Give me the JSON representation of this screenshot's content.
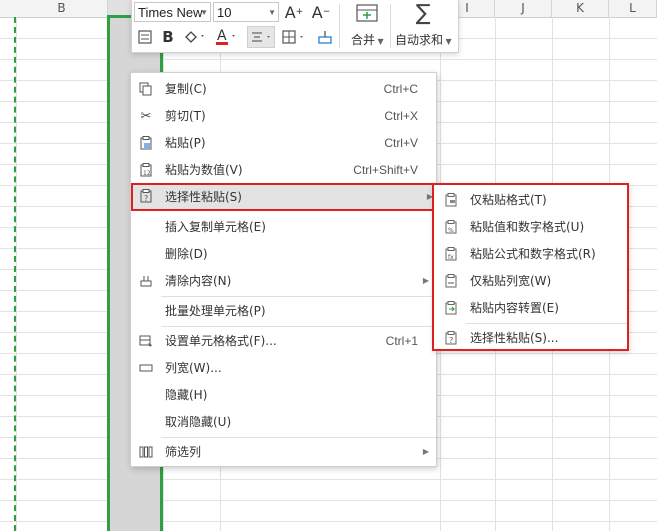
{
  "columns": [
    {
      "label": "B"
    },
    {
      "label": "I"
    },
    {
      "label": "J"
    },
    {
      "label": "K"
    },
    {
      "label": "L"
    }
  ],
  "toolbar": {
    "font_name": "Times New",
    "font_size": "10",
    "merge_label": "合并",
    "autosum_label": "自动求和",
    "grow_font_icon": "A⁺",
    "shrink_font_icon": "A⁻",
    "bold_icon": "B",
    "font_color_icon": "A",
    "sum_icon": "∑"
  },
  "context_menu": {
    "items": [
      {
        "label": "复制(C)",
        "shortcut": "Ctrl+C",
        "icon": "copy-icon"
      },
      {
        "label": "剪切(T)",
        "shortcut": "Ctrl+X",
        "icon": "scissors-icon"
      },
      {
        "label": "粘贴(P)",
        "shortcut": "Ctrl+V",
        "icon": "paste-icon"
      },
      {
        "label": "粘贴为数值(V)",
        "shortcut": "Ctrl+Shift+V",
        "icon": "paste-values-icon"
      },
      {
        "label": "选择性粘贴(S)",
        "shortcut": "",
        "icon": "paste-special-icon"
      },
      {
        "label": "插入复制单元格(E)",
        "shortcut": "",
        "icon": ""
      },
      {
        "label": "删除(D)",
        "shortcut": "",
        "icon": ""
      },
      {
        "label": "清除内容(N)",
        "shortcut": "",
        "icon": "eraser-icon"
      },
      {
        "label": "批量处理单元格(P)",
        "shortcut": "",
        "icon": ""
      },
      {
        "label": "设置单元格格式(F)...",
        "shortcut": "Ctrl+1",
        "icon": "format-cells-icon"
      },
      {
        "label": "列宽(W)...",
        "shortcut": "",
        "icon": "column-width-icon"
      },
      {
        "label": "隐藏(H)",
        "shortcut": "",
        "icon": ""
      },
      {
        "label": "取消隐藏(U)",
        "shortcut": "",
        "icon": ""
      },
      {
        "label": "筛选列",
        "shortcut": "",
        "icon": "filter-columns-icon"
      }
    ]
  },
  "submenu": {
    "items": [
      {
        "label": "仅粘贴格式(T)",
        "icon": "paste-format-icon"
      },
      {
        "label": "粘贴值和数字格式(U)",
        "icon": "paste-values-number-icon"
      },
      {
        "label": "粘贴公式和数字格式(R)",
        "icon": "paste-formula-icon"
      },
      {
        "label": "仅粘贴列宽(W)",
        "icon": "paste-column-width-icon"
      },
      {
        "label": "粘贴内容转置(E)",
        "icon": "paste-transpose-icon"
      },
      {
        "label": "选择性粘贴(S)...",
        "icon": "paste-special-icon"
      }
    ]
  },
  "colors": {
    "selection_green": "#2ea043",
    "highlight_red": "#e02020",
    "menu_hover": "#e3e3e3"
  }
}
